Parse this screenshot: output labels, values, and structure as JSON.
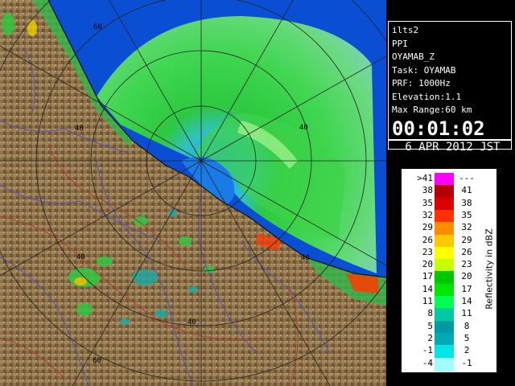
{
  "info": {
    "radar": "ilts2",
    "mode": "PPI",
    "product": "OYAMAB_Z",
    "task": "Task: OYAMAB",
    "prf": "PRF: 1000Hz",
    "elevation": "Elevation:1.1",
    "max_range": "Max Range:60 km",
    "time": "00:01:02",
    "date": " 6 APR 2012 JST"
  },
  "range_labels": [
    "60",
    "40",
    "40",
    "40",
    "40",
    "60"
  ],
  "legend": {
    "unit": "Reflectivity in dBZ",
    "rows": [
      {
        "lo": ">41",
        "hi": "---",
        "color": "#ff00ff"
      },
      {
        "lo": "38",
        "hi": "41",
        "color": "#b30000"
      },
      {
        "lo": "35",
        "hi": "38",
        "color": "#dd0000"
      },
      {
        "lo": "32",
        "hi": "35",
        "color": "#ff3000"
      },
      {
        "lo": "29",
        "hi": "32",
        "color": "#ff8c00"
      },
      {
        "lo": "26",
        "hi": "29",
        "color": "#ffc800"
      },
      {
        "lo": "23",
        "hi": "26",
        "color": "#ffff00"
      },
      {
        "lo": "20",
        "hi": "23",
        "color": "#c8ff00"
      },
      {
        "lo": "17",
        "hi": "20",
        "color": "#00c800"
      },
      {
        "lo": "14",
        "hi": "17",
        "color": "#00e600"
      },
      {
        "lo": "11",
        "hi": "14",
        "color": "#00ff50"
      },
      {
        "lo": "8",
        "hi": "11",
        "color": "#00c8a0"
      },
      {
        "lo": "5",
        "hi": "8",
        "color": "#009ba0"
      },
      {
        "lo": "2",
        "hi": "5",
        "color": "#00aab4"
      },
      {
        "lo": "-1",
        "hi": "2",
        "color": "#00e6e6"
      },
      {
        "lo": "-4",
        "hi": "-1",
        "color": "#a0ffff"
      }
    ]
  },
  "colors": {
    "sea": "#0a4ed4",
    "land": "#8f744c",
    "echo_green": "#22c83a",
    "echo_light": "#7ff07a",
    "coast_blue": "#1c8fe0",
    "grid": "#222222",
    "river": "#5a4fb4",
    "border": "#b04030"
  }
}
